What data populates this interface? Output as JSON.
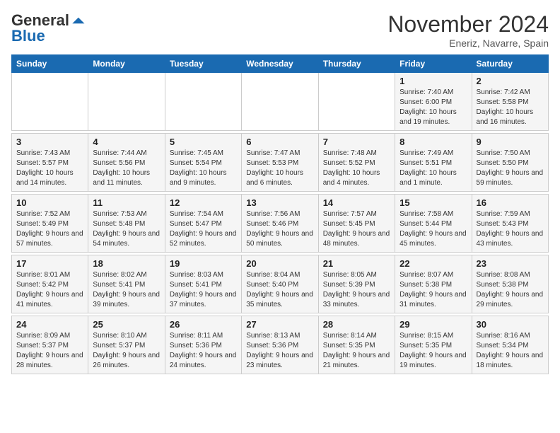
{
  "logo": {
    "text_general": "General",
    "text_blue": "Blue"
  },
  "title": "November 2024",
  "subtitle": "Eneriz, Navarre, Spain",
  "days_of_week": [
    "Sunday",
    "Monday",
    "Tuesday",
    "Wednesday",
    "Thursday",
    "Friday",
    "Saturday"
  ],
  "weeks": [
    {
      "days": [
        {
          "num": "",
          "info": ""
        },
        {
          "num": "",
          "info": ""
        },
        {
          "num": "",
          "info": ""
        },
        {
          "num": "",
          "info": ""
        },
        {
          "num": "",
          "info": ""
        },
        {
          "num": "1",
          "info": "Sunrise: 7:40 AM\nSunset: 6:00 PM\nDaylight: 10 hours and 19 minutes."
        },
        {
          "num": "2",
          "info": "Sunrise: 7:42 AM\nSunset: 5:58 PM\nDaylight: 10 hours and 16 minutes."
        }
      ]
    },
    {
      "days": [
        {
          "num": "3",
          "info": "Sunrise: 7:43 AM\nSunset: 5:57 PM\nDaylight: 10 hours and 14 minutes."
        },
        {
          "num": "4",
          "info": "Sunrise: 7:44 AM\nSunset: 5:56 PM\nDaylight: 10 hours and 11 minutes."
        },
        {
          "num": "5",
          "info": "Sunrise: 7:45 AM\nSunset: 5:54 PM\nDaylight: 10 hours and 9 minutes."
        },
        {
          "num": "6",
          "info": "Sunrise: 7:47 AM\nSunset: 5:53 PM\nDaylight: 10 hours and 6 minutes."
        },
        {
          "num": "7",
          "info": "Sunrise: 7:48 AM\nSunset: 5:52 PM\nDaylight: 10 hours and 4 minutes."
        },
        {
          "num": "8",
          "info": "Sunrise: 7:49 AM\nSunset: 5:51 PM\nDaylight: 10 hours and 1 minute."
        },
        {
          "num": "9",
          "info": "Sunrise: 7:50 AM\nSunset: 5:50 PM\nDaylight: 9 hours and 59 minutes."
        }
      ]
    },
    {
      "days": [
        {
          "num": "10",
          "info": "Sunrise: 7:52 AM\nSunset: 5:49 PM\nDaylight: 9 hours and 57 minutes."
        },
        {
          "num": "11",
          "info": "Sunrise: 7:53 AM\nSunset: 5:48 PM\nDaylight: 9 hours and 54 minutes."
        },
        {
          "num": "12",
          "info": "Sunrise: 7:54 AM\nSunset: 5:47 PM\nDaylight: 9 hours and 52 minutes."
        },
        {
          "num": "13",
          "info": "Sunrise: 7:56 AM\nSunset: 5:46 PM\nDaylight: 9 hours and 50 minutes."
        },
        {
          "num": "14",
          "info": "Sunrise: 7:57 AM\nSunset: 5:45 PM\nDaylight: 9 hours and 48 minutes."
        },
        {
          "num": "15",
          "info": "Sunrise: 7:58 AM\nSunset: 5:44 PM\nDaylight: 9 hours and 45 minutes."
        },
        {
          "num": "16",
          "info": "Sunrise: 7:59 AM\nSunset: 5:43 PM\nDaylight: 9 hours and 43 minutes."
        }
      ]
    },
    {
      "days": [
        {
          "num": "17",
          "info": "Sunrise: 8:01 AM\nSunset: 5:42 PM\nDaylight: 9 hours and 41 minutes."
        },
        {
          "num": "18",
          "info": "Sunrise: 8:02 AM\nSunset: 5:41 PM\nDaylight: 9 hours and 39 minutes."
        },
        {
          "num": "19",
          "info": "Sunrise: 8:03 AM\nSunset: 5:41 PM\nDaylight: 9 hours and 37 minutes."
        },
        {
          "num": "20",
          "info": "Sunrise: 8:04 AM\nSunset: 5:40 PM\nDaylight: 9 hours and 35 minutes."
        },
        {
          "num": "21",
          "info": "Sunrise: 8:05 AM\nSunset: 5:39 PM\nDaylight: 9 hours and 33 minutes."
        },
        {
          "num": "22",
          "info": "Sunrise: 8:07 AM\nSunset: 5:38 PM\nDaylight: 9 hours and 31 minutes."
        },
        {
          "num": "23",
          "info": "Sunrise: 8:08 AM\nSunset: 5:38 PM\nDaylight: 9 hours and 29 minutes."
        }
      ]
    },
    {
      "days": [
        {
          "num": "24",
          "info": "Sunrise: 8:09 AM\nSunset: 5:37 PM\nDaylight: 9 hours and 28 minutes."
        },
        {
          "num": "25",
          "info": "Sunrise: 8:10 AM\nSunset: 5:37 PM\nDaylight: 9 hours and 26 minutes."
        },
        {
          "num": "26",
          "info": "Sunrise: 8:11 AM\nSunset: 5:36 PM\nDaylight: 9 hours and 24 minutes."
        },
        {
          "num": "27",
          "info": "Sunrise: 8:13 AM\nSunset: 5:36 PM\nDaylight: 9 hours and 23 minutes."
        },
        {
          "num": "28",
          "info": "Sunrise: 8:14 AM\nSunset: 5:35 PM\nDaylight: 9 hours and 21 minutes."
        },
        {
          "num": "29",
          "info": "Sunrise: 8:15 AM\nSunset: 5:35 PM\nDaylight: 9 hours and 19 minutes."
        },
        {
          "num": "30",
          "info": "Sunrise: 8:16 AM\nSunset: 5:34 PM\nDaylight: 9 hours and 18 minutes."
        }
      ]
    }
  ]
}
